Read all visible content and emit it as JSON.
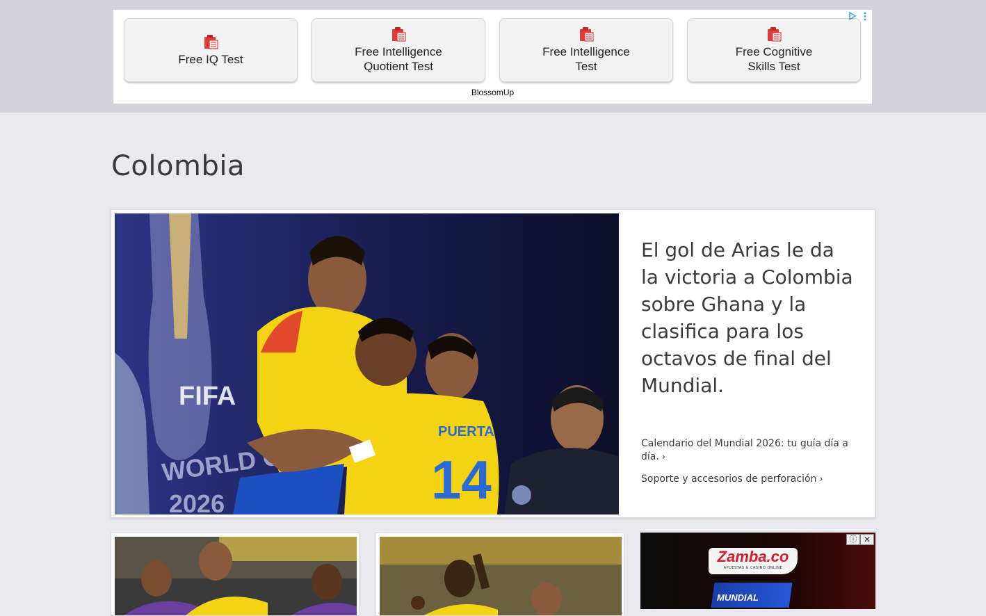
{
  "ad_banner": {
    "buttons": [
      {
        "label": "Free IQ Test",
        "icon": "clipboard-icon"
      },
      {
        "label": "Free Intelligence\nQuotient Test",
        "icon": "clipboard-icon"
      },
      {
        "label": "Free Intelligence\nTest",
        "icon": "clipboard-icon"
      },
      {
        "label": "Free Cognitive\nSkills Test",
        "icon": "clipboard-icon"
      }
    ],
    "attribution": "BlossomUp"
  },
  "page": {
    "title": "Colombia"
  },
  "hero": {
    "headline": "El gol de Arias le da la victoria a Colombia sobre Ghana y la clasifica para los octavos de final del Mundial.",
    "related": [
      {
        "label": "Calendario del Mundial 2026: tu guía día a día."
      },
      {
        "label": "Soporte y accesorios de perforación"
      }
    ],
    "image_alt_text": [
      "FIFA",
      "WORLD CUP",
      "2026",
      "PUERTA",
      "14"
    ]
  },
  "ad_right": {
    "brand": "Zamba.co",
    "tagline": "APUESTAS & CASINO ONLINE",
    "badge": "MUNDIAL",
    "info_symbol": "ⓘ",
    "close_symbol": "✕"
  },
  "colors": {
    "accent_red": "#e03a3a",
    "text_dark": "#3b3b3b",
    "jersey_yellow": "#f4d313",
    "hero_bg": "#1a1f52"
  }
}
